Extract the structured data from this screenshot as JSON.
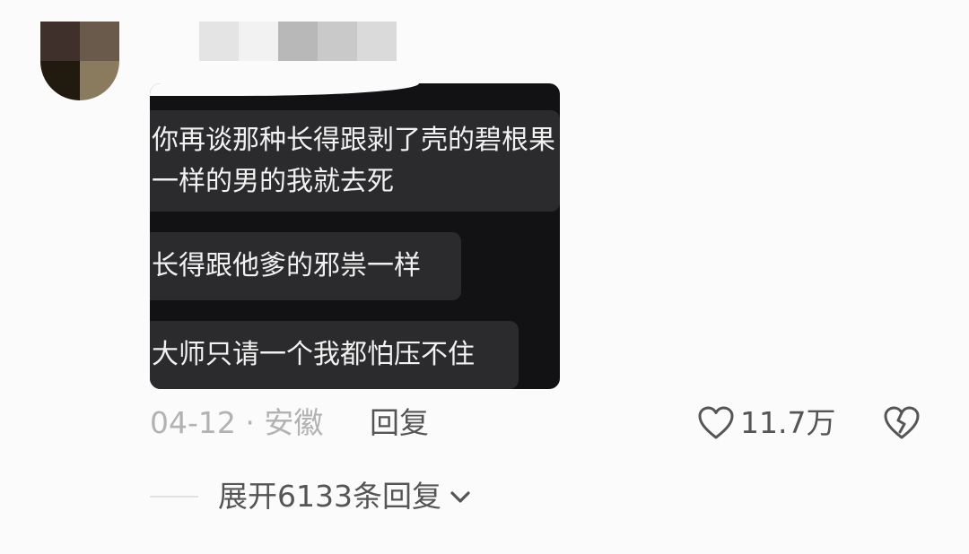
{
  "comment": {
    "image_messages": [
      [
        "你再谈那种长得跟剥了壳的碧根果",
        "一样的男的我就去死"
      ],
      [
        "长得跟他爹的邪祟一样"
      ],
      [
        "大师只请一个我都怕压不住"
      ]
    ],
    "date": "04-12",
    "separator": "·",
    "location": "安徽",
    "reply_label": "回复",
    "like_count": "11.7万",
    "expand_label": "展开6133条回复"
  },
  "icons": {
    "like": "heart-outline-icon",
    "dislike": "broken-heart-icon",
    "expand": "chevron-down-icon"
  },
  "colors": {
    "page_background": "#fbfbfb",
    "image_background": "#121214",
    "bubble": "#2b2b2d",
    "muted_text": "#b2b2b2",
    "action_text": "#555555"
  }
}
